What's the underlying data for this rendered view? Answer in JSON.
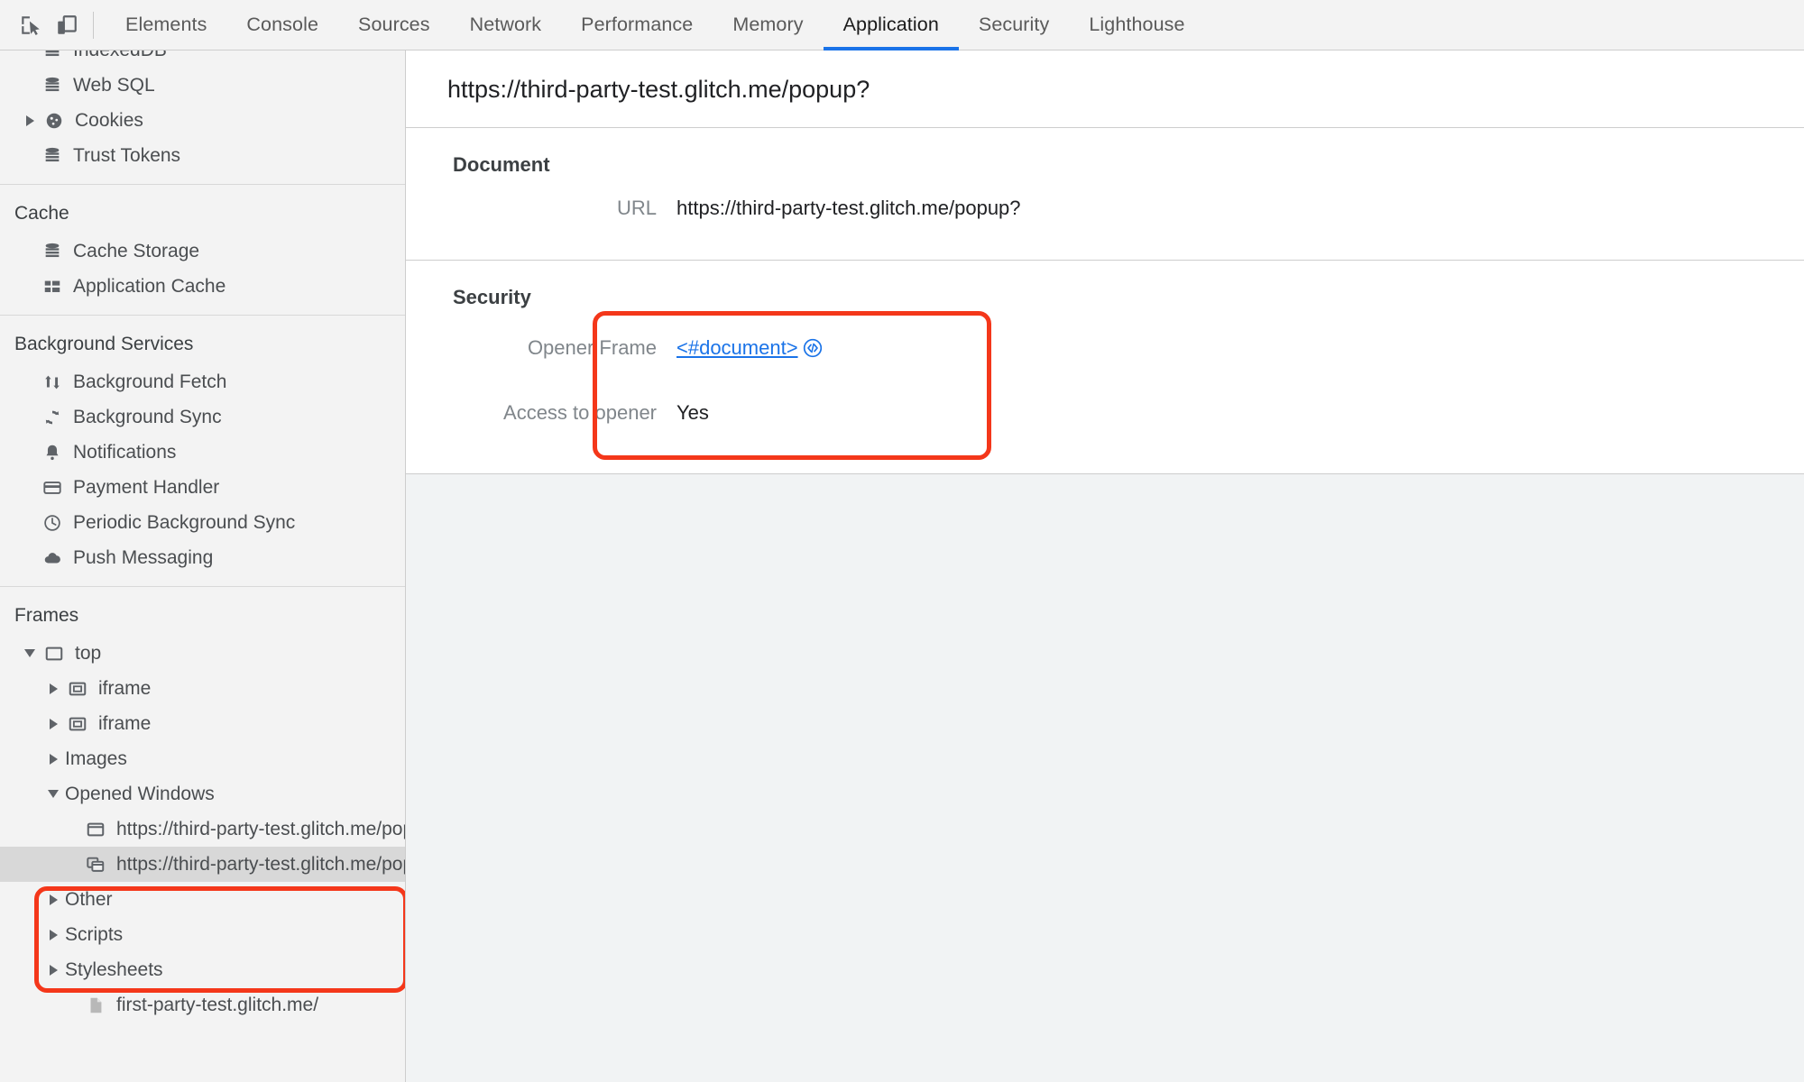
{
  "toolbar": {
    "inspect_icon": "inspect-element-icon",
    "device_icon": "device-toolbar-icon",
    "tabs": [
      {
        "label": "Elements",
        "active": false
      },
      {
        "label": "Console",
        "active": false
      },
      {
        "label": "Sources",
        "active": false
      },
      {
        "label": "Network",
        "active": false
      },
      {
        "label": "Performance",
        "active": false
      },
      {
        "label": "Memory",
        "active": false
      },
      {
        "label": "Application",
        "active": true
      },
      {
        "label": "Security",
        "active": false
      },
      {
        "label": "Lighthouse",
        "active": false
      }
    ]
  },
  "sidebar": {
    "storage": {
      "items": [
        {
          "label": "IndexedDB",
          "icon": "database-icon",
          "twisty": "none",
          "indent": 1
        },
        {
          "label": "Web SQL",
          "icon": "database-icon",
          "twisty": "none",
          "indent": 1
        },
        {
          "label": "Cookies",
          "icon": "cookie-icon",
          "twisty": "closed",
          "indent": 1
        },
        {
          "label": "Trust Tokens",
          "icon": "database-icon",
          "twisty": "none",
          "indent": 1
        }
      ]
    },
    "cache": {
      "title": "Cache",
      "items": [
        {
          "label": "Cache Storage",
          "icon": "database-icon",
          "twisty": "none",
          "indent": 1
        },
        {
          "label": "Application Cache",
          "icon": "grid-icon",
          "twisty": "none",
          "indent": 1
        }
      ]
    },
    "background_services": {
      "title": "Background Services",
      "items": [
        {
          "label": "Background Fetch",
          "icon": "up-down-arrows-icon",
          "twisty": "none",
          "indent": 1
        },
        {
          "label": "Background Sync",
          "icon": "sync-icon",
          "twisty": "none",
          "indent": 1
        },
        {
          "label": "Notifications",
          "icon": "bell-icon",
          "twisty": "none",
          "indent": 1
        },
        {
          "label": "Payment Handler",
          "icon": "credit-card-icon",
          "twisty": "none",
          "indent": 1
        },
        {
          "label": "Periodic Background Sync",
          "icon": "clock-icon",
          "twisty": "none",
          "indent": 1
        },
        {
          "label": "Push Messaging",
          "icon": "cloud-icon",
          "twisty": "none",
          "indent": 1
        }
      ]
    },
    "frames": {
      "title": "Frames",
      "items": [
        {
          "label": "top",
          "icon": "frame-icon",
          "twisty": "open",
          "indent": 1,
          "selected": false
        },
        {
          "label": "iframe",
          "icon": "iframe-icon",
          "twisty": "closed",
          "indent": 2,
          "selected": false
        },
        {
          "label": "iframe",
          "icon": "iframe-icon",
          "twisty": "closed",
          "indent": 2,
          "selected": false
        },
        {
          "label": "Images",
          "icon": "none",
          "twisty": "closed",
          "indent": 2,
          "selected": false
        },
        {
          "label": "Opened Windows",
          "icon": "none",
          "twisty": "open",
          "indent": 2,
          "selected": false
        },
        {
          "label": "https://third-party-test.glitch.me/popup?",
          "icon": "window-icon",
          "twisty": "none",
          "indent": 3,
          "selected": false
        },
        {
          "label": "https://third-party-test.glitch.me/popup?",
          "icon": "windows-stack-icon",
          "twisty": "none",
          "indent": 3,
          "selected": true
        },
        {
          "label": "Other",
          "icon": "none",
          "twisty": "closed",
          "indent": 2,
          "selected": false
        },
        {
          "label": "Scripts",
          "icon": "none",
          "twisty": "closed",
          "indent": 2,
          "selected": false
        },
        {
          "label": "Stylesheets",
          "icon": "none",
          "twisty": "closed",
          "indent": 2,
          "selected": false
        },
        {
          "label": "first-party-test.glitch.me/",
          "icon": "file-icon",
          "twisty": "none",
          "indent": 3,
          "selected": false
        }
      ]
    }
  },
  "main": {
    "header_url": "https://third-party-test.glitch.me/popup?",
    "document_section": {
      "title": "Document",
      "rows": [
        {
          "key": "URL",
          "value": "https://third-party-test.glitch.me/popup?"
        }
      ]
    },
    "security_section": {
      "title": "Security",
      "opener_frame_key": "Opener Frame",
      "opener_frame_value": "<#document>",
      "opener_frame_icon": "code-circle-icon",
      "access_to_opener_key": "Access to opener",
      "access_to_opener_value": "Yes"
    }
  },
  "annotations": {
    "color": "#f4371a",
    "boxes": [
      {
        "name": "security-opener-highlight"
      },
      {
        "name": "opened-windows-highlight"
      }
    ]
  }
}
